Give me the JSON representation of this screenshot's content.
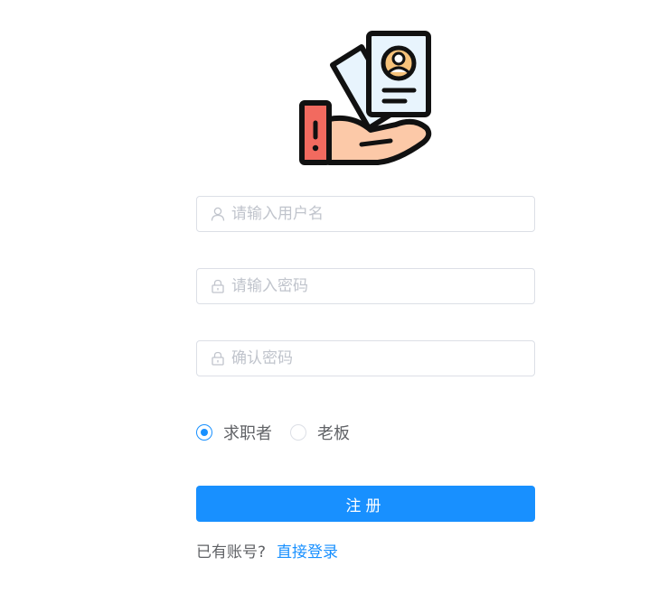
{
  "logo": {
    "icon": "hand-holding-resume-icon"
  },
  "form": {
    "username": {
      "value": "",
      "placeholder": "请输入用户名",
      "icon": "user-icon"
    },
    "password": {
      "value": "",
      "placeholder": "请输入密码",
      "icon": "lock-icon"
    },
    "confirm_password": {
      "value": "",
      "placeholder": "确认密码",
      "icon": "lock-icon"
    },
    "roles": {
      "selected": "求职者",
      "options": [
        "求职者",
        "老板"
      ]
    },
    "submit_label": "注册"
  },
  "footer": {
    "prompt": "已有账号?",
    "login_link": "直接登录"
  },
  "colors": {
    "primary": "#1890ff",
    "border": "#dcdfe6",
    "placeholder": "#c0c4cc",
    "text": "#606266"
  }
}
